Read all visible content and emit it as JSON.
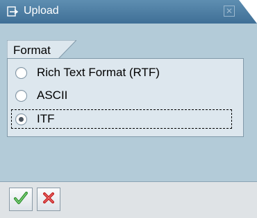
{
  "window": {
    "title": "Upload",
    "title_icon": "upload-icon",
    "close_icon": "close-icon"
  },
  "group": {
    "title": "Format"
  },
  "options": [
    {
      "label": "Rich Text Format (RTF)",
      "selected": false
    },
    {
      "label": "ASCII",
      "selected": false
    },
    {
      "label": "ITF",
      "selected": true
    }
  ],
  "footer": {
    "ok_icon": "checkmark-icon",
    "cancel_icon": "cancel-x-icon"
  },
  "colors": {
    "titlebar": "#4a7aa0",
    "window_bg": "#b3cbd8",
    "group_bg": "#dde7ee",
    "ok_green": "#3aa13a",
    "cancel_red": "#d02a2a"
  }
}
